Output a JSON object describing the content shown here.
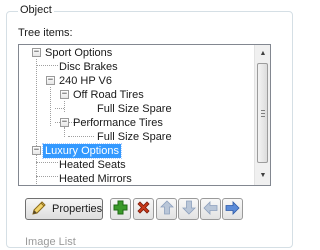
{
  "group": {
    "title": "Object"
  },
  "tree": {
    "label": "Tree items:",
    "items": [
      {
        "label": "Sport Options",
        "expanded": true,
        "selected": false
      },
      {
        "label": "Disc Brakes",
        "selected": false
      },
      {
        "label": "240 HP V6",
        "expanded": true,
        "selected": false
      },
      {
        "label": "Off Road Tires",
        "expanded": true,
        "selected": false
      },
      {
        "label": "Full Size Spare",
        "selected": false
      },
      {
        "label": "Performance Tires",
        "expanded": true,
        "selected": false
      },
      {
        "label": "Full Size Spare",
        "selected": false
      },
      {
        "label": "Luxury Options",
        "expanded": true,
        "selected": true
      },
      {
        "label": "Heated Seats",
        "selected": false
      },
      {
        "label": "Heated Mirrors",
        "selected": false
      }
    ],
    "expander_symbol": "−"
  },
  "scrollbar": {
    "up": "▲",
    "down": "▼"
  },
  "toolbar": {
    "properties_label": "Properties",
    "icons": [
      "pencil-icon",
      "add-icon",
      "delete-icon",
      "move-up-icon",
      "move-down-icon",
      "move-left-icon",
      "move-right-icon"
    ],
    "colors": {
      "add": "#3a9a2a",
      "delete": "#c83a1a",
      "arrow": "#5b8bd8",
      "arrow_disabled": "#b9c6d8"
    }
  },
  "footer": {
    "label": "Image List"
  }
}
